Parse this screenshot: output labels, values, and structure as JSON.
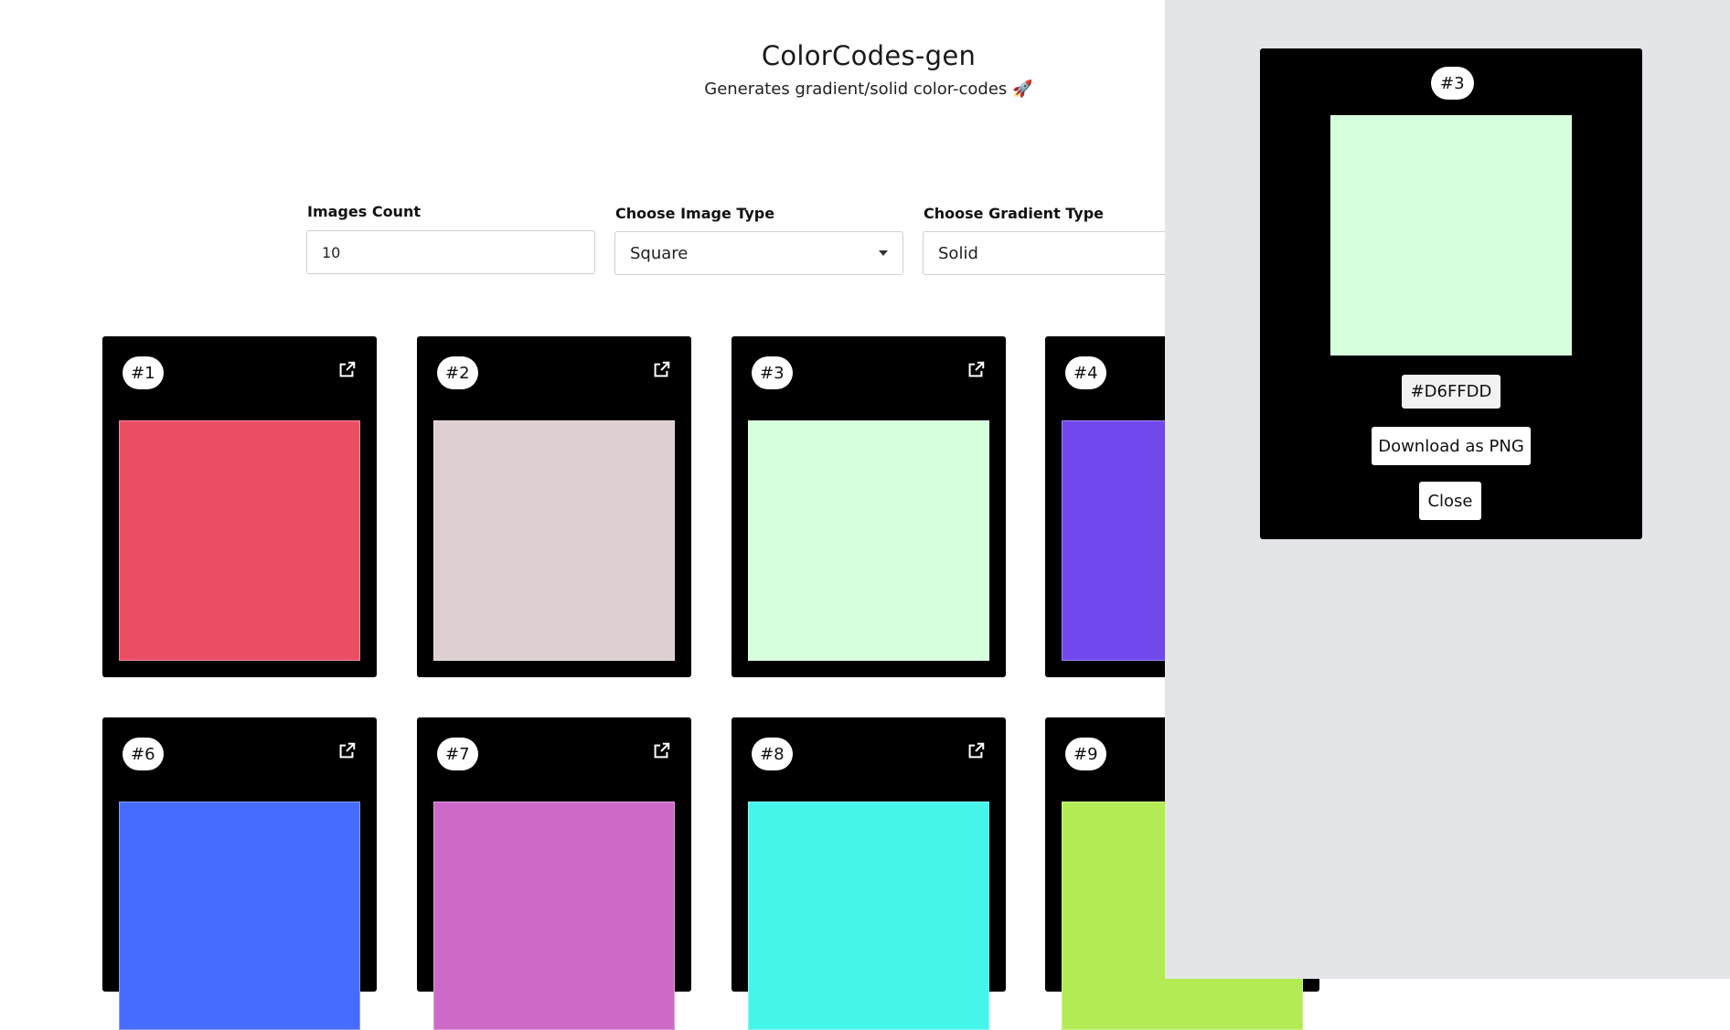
{
  "header": {
    "title": "ColorCodes-gen",
    "subtitle": "Generates gradient/solid color-codes",
    "subtitle_icon": "rocket-icon"
  },
  "form": {
    "images_count": {
      "label": "Images Count",
      "value": "10"
    },
    "image_type": {
      "label": "Choose Image Type",
      "value": "Square"
    },
    "gradient_type": {
      "label": "Choose Gradient Type",
      "value": "Solid"
    }
  },
  "cards": [
    {
      "label": "#1",
      "color": "#EB4E64"
    },
    {
      "label": "#2",
      "color": "#DECFD1"
    },
    {
      "label": "#3",
      "color": "#D6FFDD"
    },
    {
      "label": "#4",
      "color": "#7048EC"
    },
    {
      "label": "#6",
      "color": "#466CFF"
    },
    {
      "label": "#7",
      "color": "#CD6AC8"
    },
    {
      "label": "#8",
      "color": "#46F5E9"
    },
    {
      "label": "#9",
      "color": "#B2EB54"
    }
  ],
  "modal": {
    "badge": "#3",
    "color": "#D6FFDD",
    "code": "#D6FFDD",
    "download_label": "Download as PNG",
    "close_label": "Close"
  }
}
